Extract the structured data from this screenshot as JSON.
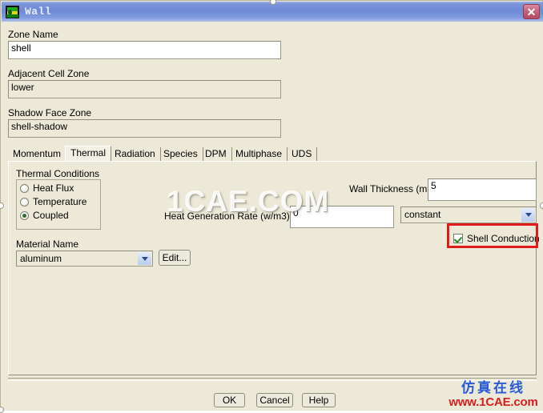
{
  "window": {
    "title": "Wall",
    "icon": "fluent-wall-icon",
    "close_label": "✕"
  },
  "fields": {
    "zone_name": {
      "label": "Zone Name",
      "value": "shell"
    },
    "adjacent_cell_zone": {
      "label": "Adjacent Cell Zone",
      "value": "lower"
    },
    "shadow_face_zone": {
      "label": "Shadow Face Zone",
      "value": "shell-shadow"
    }
  },
  "tabs": [
    {
      "label": "Momentum",
      "active": false
    },
    {
      "label": "Thermal",
      "active": true
    },
    {
      "label": "Radiation",
      "active": false
    },
    {
      "label": "Species",
      "active": false
    },
    {
      "label": "DPM",
      "active": false
    },
    {
      "label": "Multiphase",
      "active": false
    },
    {
      "label": "UDS",
      "active": false
    }
  ],
  "thermal": {
    "group_title": "Thermal Conditions",
    "conditions": [
      {
        "label": "Heat Flux",
        "checked": false
      },
      {
        "label": "Temperature",
        "checked": false
      },
      {
        "label": "Coupled",
        "checked": true
      }
    ],
    "material_name": {
      "label": "Material Name",
      "value": "aluminum"
    },
    "edit_button": "Edit...",
    "wall_thickness": {
      "label": "Wall Thickness (mm)",
      "value": "5"
    },
    "heat_generation_rate": {
      "label": "Heat Generation Rate (w/m3)",
      "value": "0"
    },
    "heat_generation_profile": {
      "value": "constant"
    },
    "shell_conduction": {
      "label": "Shell Conduction",
      "checked": true
    }
  },
  "footer": {
    "ok": "OK",
    "cancel": "Cancel",
    "help": "Help"
  },
  "watermarks": {
    "center": "1CAE.COM",
    "bottom_right_cn": "仿真在线",
    "bottom_right_url": "www.1CAE.com"
  },
  "colors": {
    "highlight": "#e01b1b",
    "titlebar": "#7b95d9",
    "dialog_bg": "#ece9d8"
  }
}
